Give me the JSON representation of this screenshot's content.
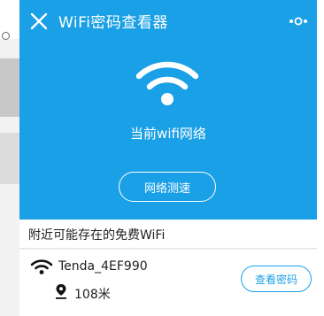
{
  "header": {
    "title": "WiFi密码查看器",
    "close_icon": "close-icon",
    "more_icon": "more-icon",
    "network_label": "当前wifi网络",
    "speed_test_label": "网络测速"
  },
  "nearby": {
    "section_title": "附近可能存在的免费WiFi",
    "items": [
      {
        "ssid": "Tenda_4EF990",
        "distance": "108米",
        "action_label": "查看密码"
      }
    ]
  },
  "colors": {
    "accent": "#1aa0e6",
    "header_bg": "#1aa0e6",
    "text": "#222222"
  }
}
